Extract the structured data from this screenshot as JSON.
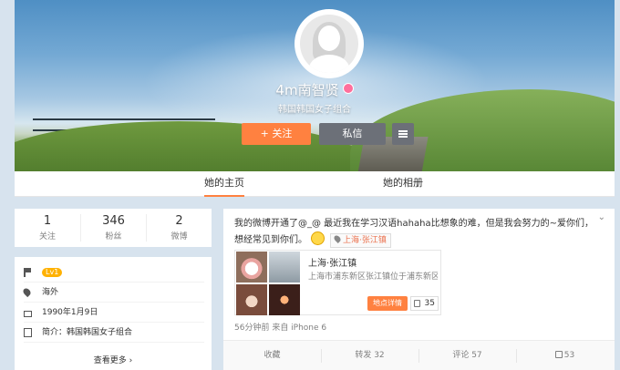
{
  "profile": {
    "name": "4m南智贤",
    "bio": "韩国韩国女子组合",
    "follow_label": "+ 关注",
    "message_label": "私信"
  },
  "tabs": [
    {
      "label": "她的主页",
      "active": true
    },
    {
      "label": "她的相册",
      "active": false
    }
  ],
  "stats": [
    {
      "value": "1",
      "label": "关注"
    },
    {
      "value": "346",
      "label": "粉丝"
    },
    {
      "value": "2",
      "label": "微博"
    }
  ],
  "info": {
    "level": "Lv1",
    "location": "海外",
    "birthday": "1990年1月9日",
    "intro": "简介：韩国韩国女子组合",
    "more": "查看更多"
  },
  "post": {
    "text": "我的微博开通了@_@ 最近我在学习汉语hahaha比想象的难，但是我会努力的~爱你们，想经常见到你们。",
    "location_tag": "上海·张江镇",
    "poi": {
      "title": "上海·张江镇",
      "address": "上海市浦东新区张江镇位于浦东新区...",
      "detail_button": "地点详情",
      "likes": "35"
    },
    "meta": "56分钟前 来自 iPhone 6",
    "actions": {
      "collect": "收藏",
      "repost": "转发 32",
      "comment": "评论 57",
      "like": "53"
    }
  },
  "colors": {
    "accent": "#ff8140",
    "button_dark": "#6c7078",
    "page_bg": "#d7e3ee",
    "location": "#eb7350"
  }
}
